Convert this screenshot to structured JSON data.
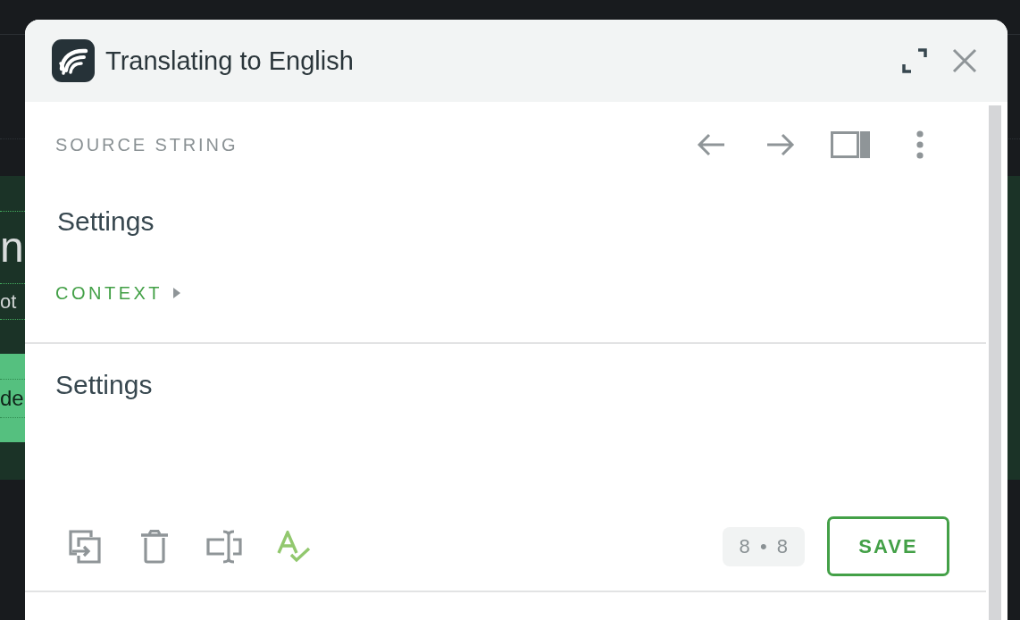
{
  "background": {
    "heading": "n",
    "subtitle": "ot",
    "button": "de"
  },
  "dialog": {
    "title": "Translating to English",
    "source": {
      "label": "SOURCE STRING",
      "text": "Settings",
      "context": {
        "label": "CONTEXT",
        "expanded": false
      }
    },
    "translation": {
      "value": "Settings",
      "counter": "8 • 8",
      "save": "SAVE"
    }
  }
}
